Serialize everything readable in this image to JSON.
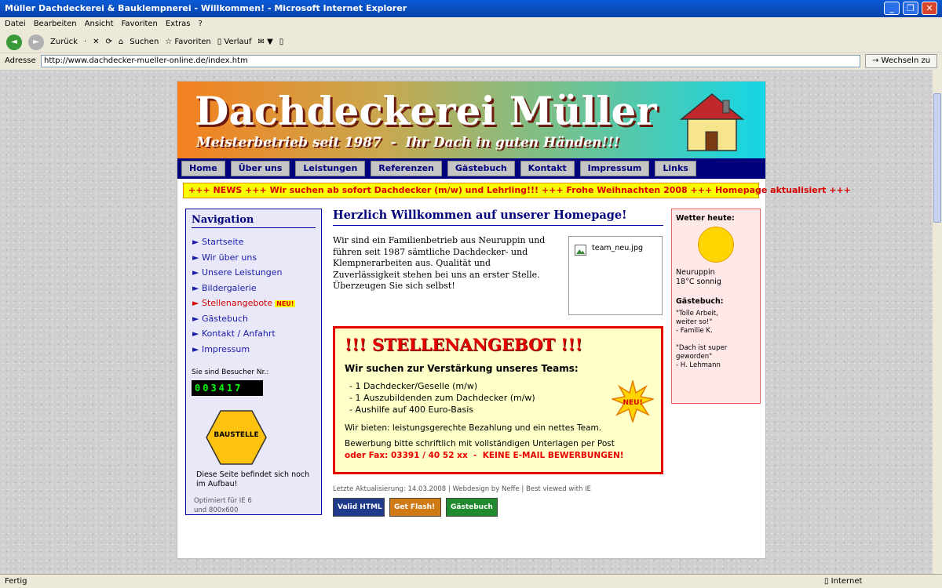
{
  "window": {
    "title": "Müller Dachdeckerei & Bauklempnerei - Willkommen! - Microsoft Internet Explorer",
    "minimize": "_",
    "maximize": "❐",
    "close": "✕"
  },
  "menubar": [
    "Datei",
    "Bearbeiten",
    "Ansicht",
    "Favoriten",
    "Extras",
    "?"
  ],
  "toolbar": {
    "back": "◄",
    "forward": "►",
    "zurueck": "Zurück",
    "dot": "·",
    "stop": "✕",
    "refresh": "⟳",
    "home": "⌂",
    "search": "Suchen",
    "favorites": "☆ Favoriten",
    "history": "▯ Verlauf",
    "mail": "✉ ▼",
    "print": "▯"
  },
  "address": {
    "label": "Adresse",
    "url": "http://www.dachdecker-mueller-online.de/index.htm",
    "go": "→ Wechseln zu"
  },
  "banner": {
    "title": "Dachdeckerei Müller",
    "subtitle": "Meisterbetrieb seit 1987  -  Ihr Dach in guten Händen!!!"
  },
  "nav_tabs": [
    "Home",
    "Über uns",
    "Leistungen",
    "Referenzen",
    "Gästebuch",
    "Kontakt",
    "Impressum",
    "Links"
  ],
  "ticker": "+++ NEWS +++ Wir suchen ab sofort Dachdecker (m/w) und Lehrling!!! +++ Frohe Weihnachten 2008 +++ Homepage aktualisiert +++",
  "leftnav": {
    "heading": "Navigation",
    "items": [
      {
        "label": "► Startseite"
      },
      {
        "label": "► Wir über uns"
      },
      {
        "label": "► Unsere Leistungen"
      },
      {
        "label": "► Bildergalerie"
      },
      {
        "label": "► Stellenangebote",
        "badge": "NEU!"
      },
      {
        "label": "► Gästebuch"
      },
      {
        "label": "► Kontakt / Anfahrt"
      },
      {
        "label": "► Impressum"
      }
    ],
    "visitors_label": "Sie sind Besucher Nr.:",
    "counter": "003417",
    "sign_text": "BAUSTELLE",
    "construction_note": "Diese Seite befindet sich noch im Aufbau!",
    "optimized_line1": "Optimiert für IE 6",
    "optimized_line2": "und 800x600"
  },
  "main": {
    "welcome": "Herzlich Willkommen auf unserer Homepage!",
    "intro": "Wir sind ein Familienbetrieb aus Neuruppin und führen seit 1987 sämtliche Dachdecker- und Klempnerarbeiten aus. Qualität und Zuverlässigkeit stehen bei uns an erster Stelle. Überzeugen Sie sich selbst!",
    "image_name": "team_neu.jpg",
    "job": {
      "heading": "!!! STELLENANGEBOT !!!",
      "subheading": "Wir suchen zur Verstärkung unseres Teams:",
      "positions": [
        "- 1 Dachdecker/Geselle (m/w)",
        "- 1 Auszubildenden zum Dachdecker (m/w)",
        "- Aushilfe auf 400 Euro-Basis"
      ],
      "offer": "Wir bieten: leistungsgerechte Bezahlung und ein nettes Team.",
      "apply": "Bewerbung bitte schriftlich mit vollständigen Unterlagen per Post",
      "fax": "oder Fax: 03391 / 40 52 xx  -  KEINE E-MAIL BEWERBUNGEN!",
      "star_label": "NEU!"
    },
    "footer": "Letzte Aktualisierung: 14.03.2008  |  Webdesign by Neffe  |  Best viewed with IE",
    "buttons": [
      {
        "label": "Valid HTML",
        "color": "#1f3a8a"
      },
      {
        "label": "Get Flash!",
        "color": "#d07a16"
      },
      {
        "label": "Gästebuch",
        "color": "#1f8a2e"
      }
    ]
  },
  "right": {
    "weather_heading": "Wetter heute:",
    "city": "Neuruppin",
    "temp": "18°C sonnig",
    "guestbook_heading": "Gästebuch:",
    "quote1_a": "\"Tolle Arbeit,",
    "quote1_b": "weiter so!\"",
    "quote1_c": "- Familie K.",
    "quote2_a": "\"Dach ist super",
    "quote2_b": "geworden\"",
    "quote2_c": "- H. Lehmann"
  },
  "status": {
    "left": "Fertig",
    "right": "▯ Internet"
  }
}
